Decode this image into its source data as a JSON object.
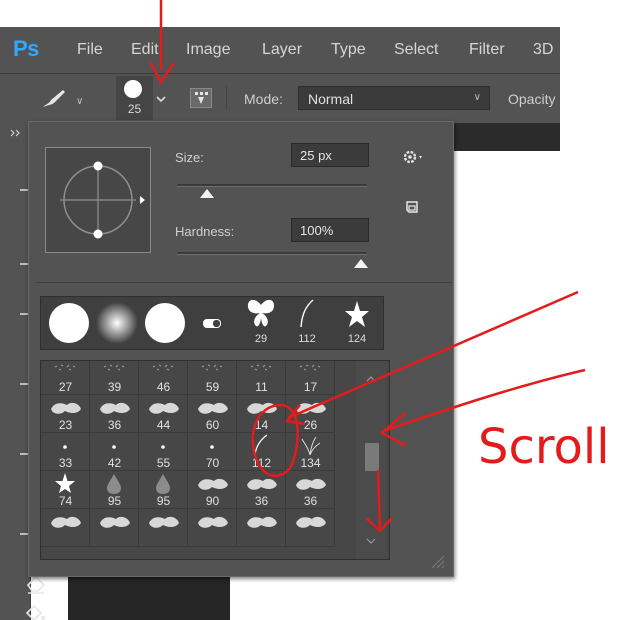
{
  "app": {
    "logo": "Ps"
  },
  "menu": [
    "File",
    "Edit",
    "Image",
    "Layer",
    "Type",
    "Select",
    "Filter",
    "3D"
  ],
  "options_bar": {
    "brush_size": "25",
    "mode_label": "Mode:",
    "mode_value": "Normal",
    "opacity_label": "Opacity"
  },
  "picker": {
    "size_label": "Size:",
    "size_value": "25 px",
    "hardness_label": "Hardness:",
    "hardness_value": "100%",
    "size_level": 0.16,
    "hardness_level": 1.0,
    "recent_brushes": [
      {
        "icon": "hard-round-brush",
        "number": ""
      },
      {
        "icon": "soft-round-brush",
        "number": ""
      },
      {
        "icon": "hard-round-brush",
        "number": ""
      },
      {
        "icon": "eraser-brush",
        "number": ""
      },
      {
        "icon": "butterfly-brush",
        "number": "29"
      },
      {
        "icon": "stroke-brush",
        "number": "112"
      },
      {
        "icon": "star-brush",
        "number": "124"
      }
    ],
    "grid_rows": [
      [
        "27",
        "39",
        "46",
        "59",
        "11",
        "17"
      ],
      [
        "23",
        "36",
        "44",
        "60",
        "14",
        "26"
      ],
      [
        "33",
        "42",
        "55",
        "70",
        "112",
        "134"
      ],
      [
        "74",
        "95",
        "95",
        "90",
        "36",
        "36"
      ],
      [
        "",
        "",
        "",
        "",
        "",
        ""
      ]
    ],
    "scroll_position": 0.42
  },
  "annotation": {
    "text": "Scroll",
    "color": "#e31b1b"
  },
  "colors": {
    "ui_bg": "#535353",
    "panel_dark": "#474747",
    "accent_blue": "#31a8ff"
  }
}
